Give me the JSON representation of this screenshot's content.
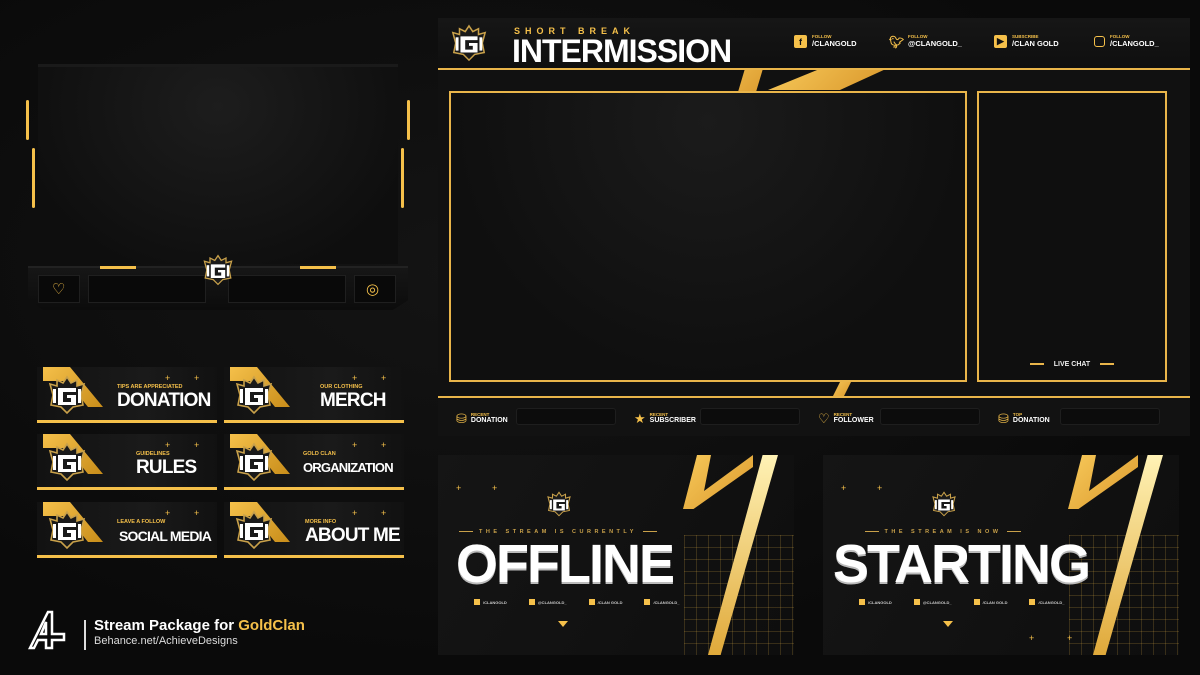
{
  "colors": {
    "accent": "#f5c04a",
    "background": "#0b0b0b",
    "text": "#ffffff"
  },
  "webcam": {
    "left_icon": "heart-hand-icon",
    "right_icon": "coin-stack-icon"
  },
  "panels": [
    {
      "subtitle": "TIPS ARE APPRECIATED",
      "title": "DONATION"
    },
    {
      "subtitle": "OUR CLOTHING",
      "title": "MERCH"
    },
    {
      "subtitle": "GUIDELINES",
      "title": "RULES"
    },
    {
      "subtitle": "GOLD CLAN",
      "title": "ORGANIZATION"
    },
    {
      "subtitle": "LEAVE A FOLLOW",
      "title": "SOCIAL MEDIA"
    },
    {
      "subtitle": "MORE INFO",
      "title": "ABOUT ME"
    }
  ],
  "intermission": {
    "kicker": "SHORT BREAK",
    "title": "INTERMISSION",
    "socials": [
      {
        "icon": "facebook-icon",
        "label": "FOLLOW",
        "value": "/CLANGOLD"
      },
      {
        "icon": "twitter-icon",
        "label": "FOLLOW",
        "value": "@CLANGOLD_"
      },
      {
        "icon": "youtube-icon",
        "label": "SUBSCRIBE",
        "value": "/CLAN GOLD"
      },
      {
        "icon": "instagram-icon",
        "label": "FOLLOW",
        "value": "/CLANGOLD_"
      }
    ],
    "chat_label": "LIVE CHAT",
    "stats": [
      {
        "icon": "coins-icon",
        "label": "RECENT",
        "value": "DONATION"
      },
      {
        "icon": "star-icon",
        "label": "RECENT",
        "value": "SUBSCRIBER"
      },
      {
        "icon": "heart-hand-icon",
        "label": "RECENT",
        "value": "FOLLOWER"
      },
      {
        "icon": "coins-icon",
        "label": "TOP",
        "value": "DONATION"
      }
    ]
  },
  "offline": {
    "caption": "THE STREAM IS CURRENTLY",
    "title": "OFFLINE",
    "socials": [
      "/CLANGOLD",
      "@CLANGOLD_",
      "/CLAN GOLD",
      "/CLANGOLD_"
    ]
  },
  "starting": {
    "caption": "THE STREAM IS NOW",
    "title": "STARTING",
    "socials": [
      "/CLANGOLD",
      "@CLANGOLD_",
      "/CLAN GOLD",
      "/CLANGOLD_"
    ]
  },
  "branding": {
    "line1_prefix": "Stream Package for ",
    "line1_highlight": "GoldClan",
    "line2": "Behance.net/AchieveDesigns"
  }
}
